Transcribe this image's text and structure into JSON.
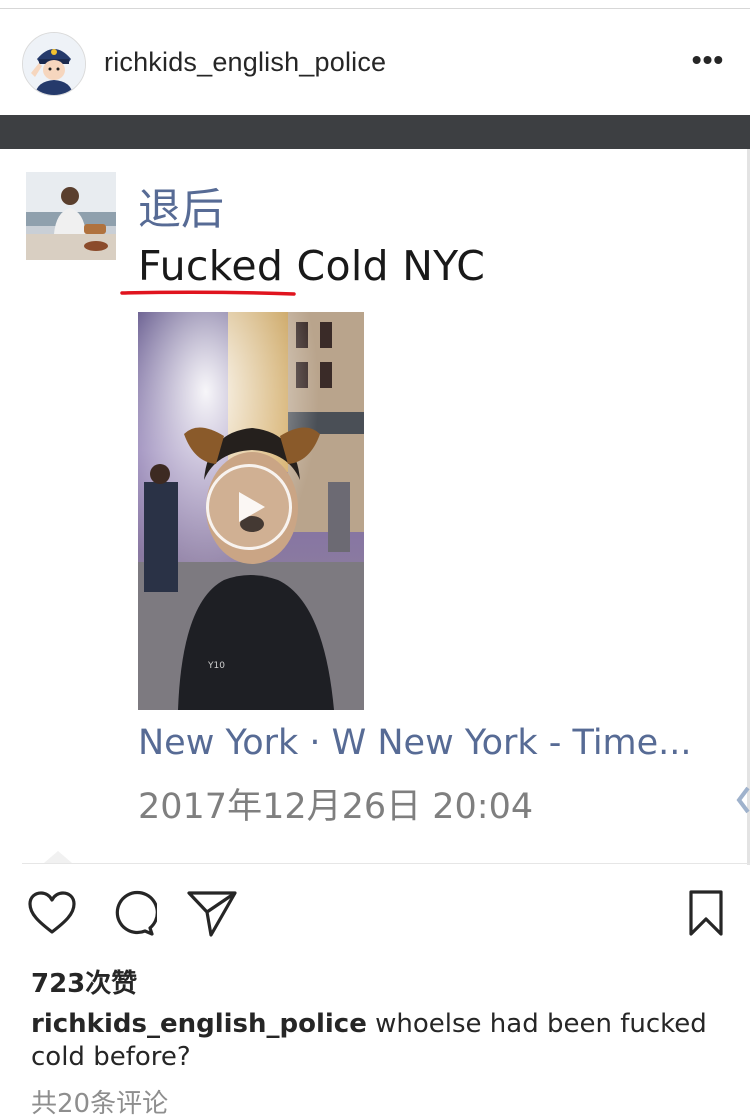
{
  "post": {
    "username": "richkids_english_police",
    "more_glyph": "•••",
    "likes": "723次赞",
    "caption_user": "richkids_english_police",
    "caption_text": " whoelse had been fucked cold before?",
    "comments_link": "共20条评论"
  },
  "embedded": {
    "name": "退后",
    "text": "Fucked Cold NYC",
    "location": "New York · W New York - Time...",
    "timestamp": "2017年12月26日 20:04"
  },
  "icons": {
    "like": "heart-icon",
    "comment": "comment-bubble-icon",
    "share": "paper-plane-icon",
    "save": "bookmark-icon",
    "play": "play-icon"
  },
  "colors": {
    "link_blue": "#576b95",
    "underline_red": "#e0141e",
    "text": "#262626",
    "muted": "#8e8e8e"
  }
}
